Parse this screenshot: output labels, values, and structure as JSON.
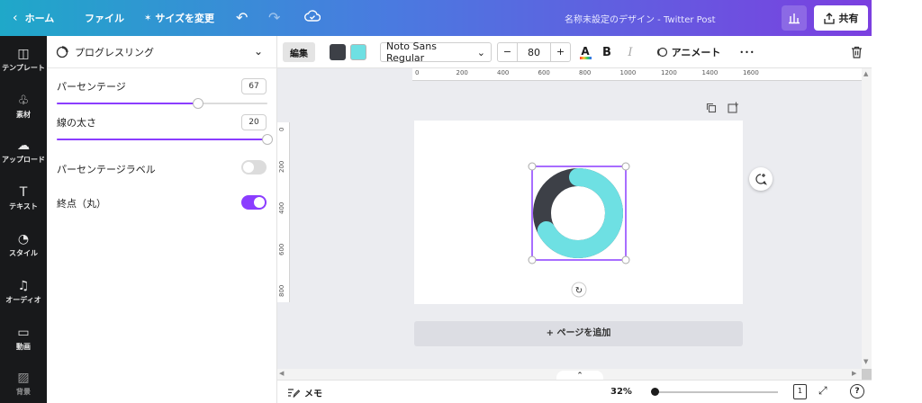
{
  "topbar": {
    "home": "ホーム",
    "file": "ファイル",
    "resize": "サイズを変更",
    "title": "名称未設定のデザイン - Twitter Post",
    "share": "共有"
  },
  "rail": [
    {
      "label": "テンプレート",
      "icon": "template-icon"
    },
    {
      "label": "素材",
      "icon": "elements-icon"
    },
    {
      "label": "アップロード",
      "icon": "upload-icon"
    },
    {
      "label": "テキスト",
      "icon": "text-icon"
    },
    {
      "label": "スタイル",
      "icon": "style-icon"
    },
    {
      "label": "オーディオ",
      "icon": "audio-icon"
    },
    {
      "label": "動画",
      "icon": "video-icon"
    },
    {
      "label": "背景",
      "icon": "background-icon"
    }
  ],
  "panel": {
    "header": "プログレスリング",
    "percentage_label": "パーセンテージ",
    "percentage_value": "67",
    "percentage_fraction": 0.67,
    "stroke_label": "線の太さ",
    "stroke_value": "20",
    "stroke_fraction": 1.0,
    "pct_label_toggle": "パーセンテージラベル",
    "pct_label_on": false,
    "rounded_toggle": "終点（丸）",
    "rounded_on": true
  },
  "toolbar": {
    "edit": "編集",
    "color1": "#3d4047",
    "color2": "#6ee0e3",
    "font": "Noto Sans Regular",
    "font_size": "80",
    "minus": "−",
    "plus": "+",
    "bold": "B",
    "italic": "I",
    "animate": "アニメート",
    "more": "•••"
  },
  "rulers": {
    "h": [
      "0",
      "200",
      "400",
      "600",
      "800",
      "1000",
      "1200",
      "1400",
      "1600"
    ],
    "v": [
      "0",
      "200",
      "400",
      "600",
      "800"
    ]
  },
  "canvas": {
    "ring_track_color": "#3d4047",
    "ring_progress_color": "#6ee0e3",
    "ring_percentage": 67,
    "add_page": "+ ページを追加"
  },
  "bottombar": {
    "notes": "メモ",
    "zoom": "32%",
    "page_count": "1",
    "help": "?"
  }
}
